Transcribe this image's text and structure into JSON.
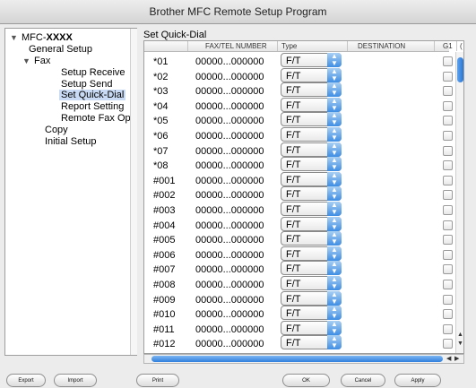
{
  "window": {
    "title": "Brother MFC Remote Setup Program"
  },
  "tree": {
    "items": [
      {
        "label": "MFC-",
        "bold": "XXXX"
      },
      {
        "label": "General Setup"
      },
      {
        "label": "Fax"
      },
      {
        "label": "Setup Receive"
      },
      {
        "label": "Setup Send"
      },
      {
        "label": "Set Quick-Dial"
      },
      {
        "label": "Report Setting"
      },
      {
        "label": "Remote Fax Opt"
      },
      {
        "label": "Copy"
      },
      {
        "label": "Initial Setup"
      }
    ],
    "selected": "Set Quick-Dial"
  },
  "main": {
    "heading": "Set Quick-Dial",
    "columns": [
      "FAX/TEL NUMBER",
      "Type",
      "DESTINATION",
      "G1",
      "("
    ],
    "rows": [
      {
        "label": "*01",
        "number": "00000...000000",
        "type": "F/T"
      },
      {
        "label": "*02",
        "number": "00000...000000",
        "type": "F/T"
      },
      {
        "label": "*03",
        "number": "00000...000000",
        "type": "F/T"
      },
      {
        "label": "*04",
        "number": "00000...000000",
        "type": "F/T"
      },
      {
        "label": "*05",
        "number": "00000...000000",
        "type": "F/T"
      },
      {
        "label": "*06",
        "number": "00000...000000",
        "type": "F/T"
      },
      {
        "label": "*07",
        "number": "00000...000000",
        "type": "F/T"
      },
      {
        "label": "*08",
        "number": "00000...000000",
        "type": "F/T"
      },
      {
        "label": "#001",
        "number": "00000...000000",
        "type": "F/T"
      },
      {
        "label": "#002",
        "number": "00000...000000",
        "type": "F/T"
      },
      {
        "label": "#003",
        "number": "00000...000000",
        "type": "F/T"
      },
      {
        "label": "#004",
        "number": "00000...000000",
        "type": "F/T"
      },
      {
        "label": "#005",
        "number": "00000...000000",
        "type": "F/T"
      },
      {
        "label": "#006",
        "number": "00000...000000",
        "type": "F/T"
      },
      {
        "label": "#007",
        "number": "00000...000000",
        "type": "F/T"
      },
      {
        "label": "#008",
        "number": "00000...000000",
        "type": "F/T"
      },
      {
        "label": "#009",
        "number": "00000...000000",
        "type": "F/T"
      },
      {
        "label": "#010",
        "number": "00000...000000",
        "type": "F/T"
      },
      {
        "label": "#011",
        "number": "00000...000000",
        "type": "F/T"
      },
      {
        "label": "#012",
        "number": "00000...000000",
        "type": "F/T"
      }
    ]
  },
  "buttons": {
    "export": "Export",
    "import": "Import",
    "print": "Print",
    "ok": "OK",
    "cancel": "Cancel",
    "apply": "Apply"
  },
  "icons": {
    "popup_arrows": "up-down-arrows-icon",
    "expand": "disclosure-triangle-icon"
  },
  "colors": {
    "accent": "#3f8ee4",
    "selection": "#c9dbf4"
  }
}
